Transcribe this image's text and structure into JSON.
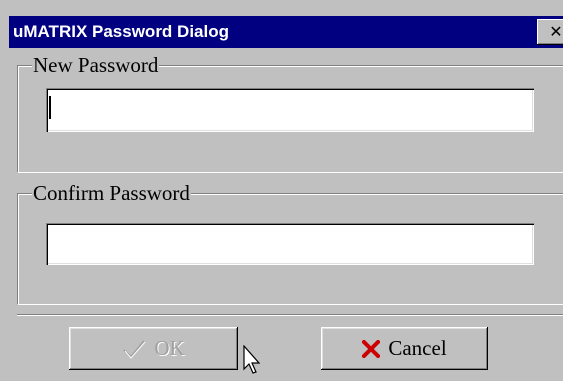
{
  "window": {
    "title": "uMATRIX Password Dialog",
    "close_glyph": "✕"
  },
  "new_password": {
    "label": "New Password",
    "value": ""
  },
  "confirm_password": {
    "label": "Confirm Password",
    "value": ""
  },
  "buttons": {
    "ok_label": "OK",
    "ok_icon": "check-icon",
    "ok_enabled": false,
    "cancel_label": "Cancel",
    "cancel_icon": "x-icon"
  },
  "colors": {
    "titlebar": "#000080",
    "face": "#c0c0c0",
    "cancel_icon": "#cc0000",
    "disabled_text": "#a0a0a0"
  }
}
